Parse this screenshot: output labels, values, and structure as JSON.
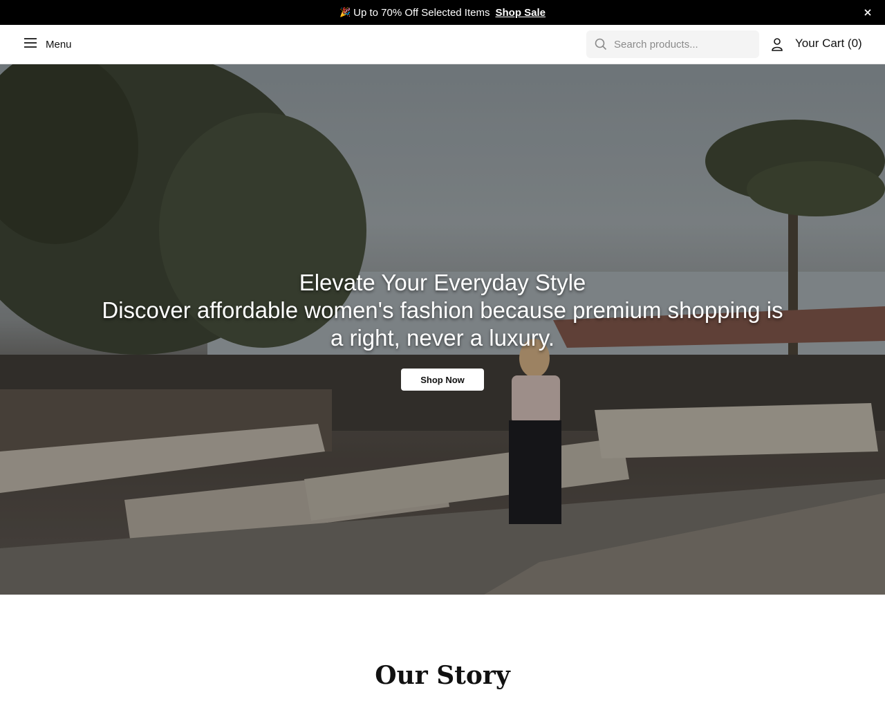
{
  "announcement": {
    "emoji": "🎉",
    "text": "Up to 70% Off Selected Items",
    "link_label": "Shop Sale",
    "close_icon": "close-icon"
  },
  "header": {
    "menu_label": "Menu",
    "menu_icon": "hamburger-icon",
    "search": {
      "placeholder": "Search products...",
      "value": "",
      "icon": "search-icon"
    },
    "account_icon": "user-icon",
    "cart_label": "Your Cart (0)"
  },
  "hero": {
    "title": "Elevate Your Everyday Style",
    "subtitle": "Discover affordable women's fashion because premium shopping is a right, never a luxury.",
    "cta_label": "Shop Now"
  },
  "story": {
    "title": "Our Story"
  },
  "colors": {
    "announce_bg": "#000000",
    "header_bg": "#ffffff",
    "button_bg": "#ffffff",
    "search_bg": "#f4f4f4"
  }
}
